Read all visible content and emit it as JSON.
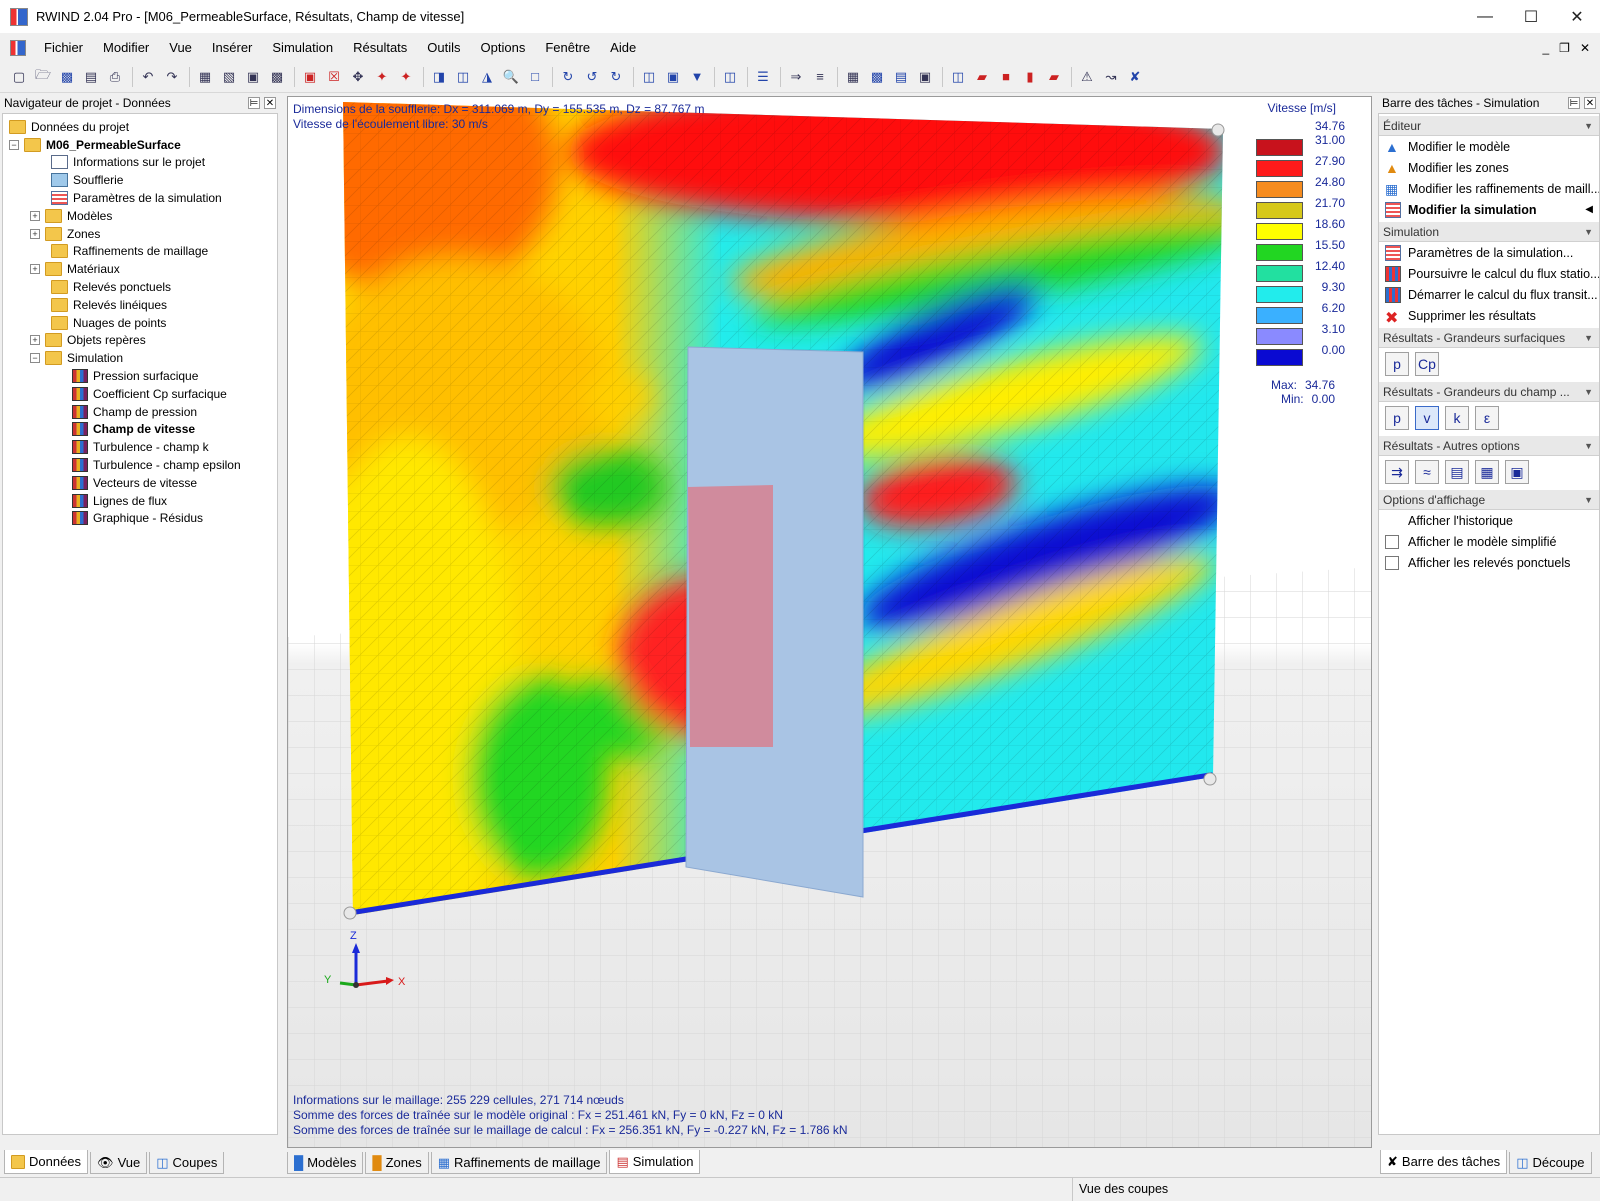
{
  "window": {
    "title": "RWIND 2.04 Pro - [M06_PermeableSurface, Résultats, Champ de vitesse]",
    "minimize": "—",
    "maximize": "☐",
    "close": "✕"
  },
  "menu": {
    "items": [
      "Fichier",
      "Modifier",
      "Vue",
      "Insérer",
      "Simulation",
      "Résultats",
      "Outils",
      "Options",
      "Fenêtre",
      "Aide"
    ],
    "mdi_min": "_",
    "mdi_restore": "❐",
    "mdi_close": "✕"
  },
  "left_panel": {
    "title": "Navigateur de projet - Données",
    "tree": [
      {
        "label": "Données du projet"
      },
      {
        "label": "M06_PermeableSurface",
        "bold": true,
        "expander": "−"
      },
      {
        "label": "Informations sur le projet"
      },
      {
        "label": "Soufflerie"
      },
      {
        "label": "Paramètres de la simulation"
      },
      {
        "label": "Modèles",
        "expander": "+"
      },
      {
        "label": "Zones",
        "expander": "+"
      },
      {
        "label": "Raffinements de maillage"
      },
      {
        "label": "Matériaux",
        "expander": "+"
      },
      {
        "label": "Relevés ponctuels"
      },
      {
        "label": "Relevés linéiques"
      },
      {
        "label": "Nuages de points"
      },
      {
        "label": "Objets repères",
        "expander": "+"
      },
      {
        "label": "Simulation",
        "expander": "−"
      },
      {
        "label": "Pression surfacique"
      },
      {
        "label": "Coefficient Cp surfacique"
      },
      {
        "label": "Champ de pression"
      },
      {
        "label": "Champ de vitesse",
        "bold": true
      },
      {
        "label": "Turbulence - champ k"
      },
      {
        "label": "Turbulence - champ epsilon"
      },
      {
        "label": "Vecteurs de vitesse"
      },
      {
        "label": "Lignes de flux"
      },
      {
        "label": "Graphique - Résidus"
      }
    ],
    "tabs": [
      "Données",
      "Vue",
      "Coupes"
    ]
  },
  "viewport": {
    "info_top": [
      "Dimensions de la soufflerie: Dx = 311.069 m, Dy = 155.535 m, Dz = 87.767 m",
      "Vitesse de l'écoulement libre: 30 m/s"
    ],
    "info_bottom": [
      "Informations sur le maillage: 255 229 cellules, 271 714 nœuds",
      "Somme des forces de traînée sur le modèle original : Fx = 251.461 kN, Fy = 0 kN, Fz = 0 kN",
      "Somme des forces de traînée sur le maillage de calcul : Fx = 256.351 kN, Fy = -0.227 kN, Fz = 1.786 kN"
    ],
    "axes": {
      "z": "Z",
      "x": "X",
      "y": "Y"
    },
    "legend": {
      "title": "Vitesse [m/s]",
      "top_value": "34.76",
      "bands": [
        {
          "color": "#c8121c",
          "value": "31.00"
        },
        {
          "color": "#ff1a1a",
          "value": "27.90"
        },
        {
          "color": "#f68c1f",
          "value": "24.80"
        },
        {
          "color": "#d6c81a",
          "value": "21.70"
        },
        {
          "color": "#ffff00",
          "value": "18.60"
        },
        {
          "color": "#22d622",
          "value": "15.50"
        },
        {
          "color": "#22e0a0",
          "value": "12.40"
        },
        {
          "color": "#22ecec",
          "value": "9.30"
        },
        {
          "color": "#3ab0ff",
          "value": "6.20"
        },
        {
          "color": "#8a8aff",
          "value": "3.10"
        },
        {
          "color": "#0a0ad2",
          "value": "0.00"
        }
      ],
      "max_label": "Max:",
      "max_value": "34.76",
      "min_label": "Min:",
      "min_value": "0.00"
    },
    "tabs": [
      "Modèles",
      "Zones",
      "Raffinements de maillage",
      "Simulation"
    ]
  },
  "right_panel": {
    "title": "Barre des tâches - Simulation",
    "sections": {
      "editor": {
        "title": "Éditeur",
        "items": [
          "Modifier le modèle",
          "Modifier les zones",
          "Modifier les raffinements de maill...",
          "Modifier la simulation"
        ]
      },
      "simulation": {
        "title": "Simulation",
        "items": [
          "Paramètres de la simulation...",
          "Poursuivre le calcul du flux statio...",
          "Démarrer le calcul du flux transit...",
          "Supprimer les résultats"
        ]
      },
      "surface": {
        "title": "Résultats - Grandeurs surfaciques",
        "buttons": [
          "p",
          "Cp"
        ]
      },
      "field": {
        "title": "Résultats - Grandeurs du champ ...",
        "buttons": [
          "p",
          "v",
          "k",
          "ε"
        ]
      },
      "other": {
        "title": "Résultats - Autres options"
      },
      "display": {
        "title": "Options d'affichage",
        "items": [
          "Afficher l'historique",
          "Afficher le modèle simplifié",
          "Afficher les relevés ponctuels"
        ]
      }
    },
    "tabs": [
      "Barre des tâches",
      "Découpe"
    ]
  },
  "statusbar": {
    "text": "Vue des coupes"
  }
}
